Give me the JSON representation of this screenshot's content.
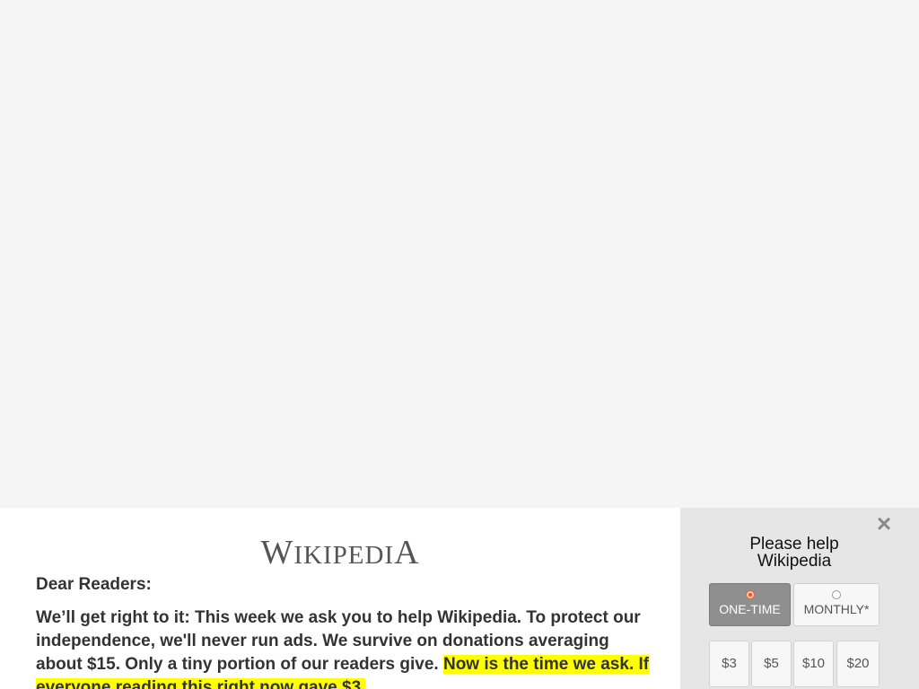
{
  "banner": {
    "logo_text_parts": [
      "W",
      "IKIPEDI",
      "A"
    ],
    "greeting": "Dear Readers:",
    "body_plain": "We’ll get right to it: This week we ask you to help Wikipedia. To protect our independence, we'll never run ads. We survive on donations averaging about $15. Only a tiny portion of our readers give. ",
    "body_highlight": "Now is the time we ask. If everyone reading this right now gave $3,"
  },
  "donate": {
    "title": "Please help Wikipedia",
    "close_icon": "×",
    "frequency": [
      {
        "label": "ONE-TIME",
        "selected": true
      },
      {
        "label": "MONTHLY*",
        "selected": false
      }
    ],
    "amounts": [
      "$3",
      "$5",
      "$10",
      "$20"
    ]
  },
  "colors": {
    "page_background": "#f5f5f5",
    "panel_background": "#e6e6e6",
    "highlight": "#ffff00",
    "selected_button": "#8f8f8f"
  }
}
